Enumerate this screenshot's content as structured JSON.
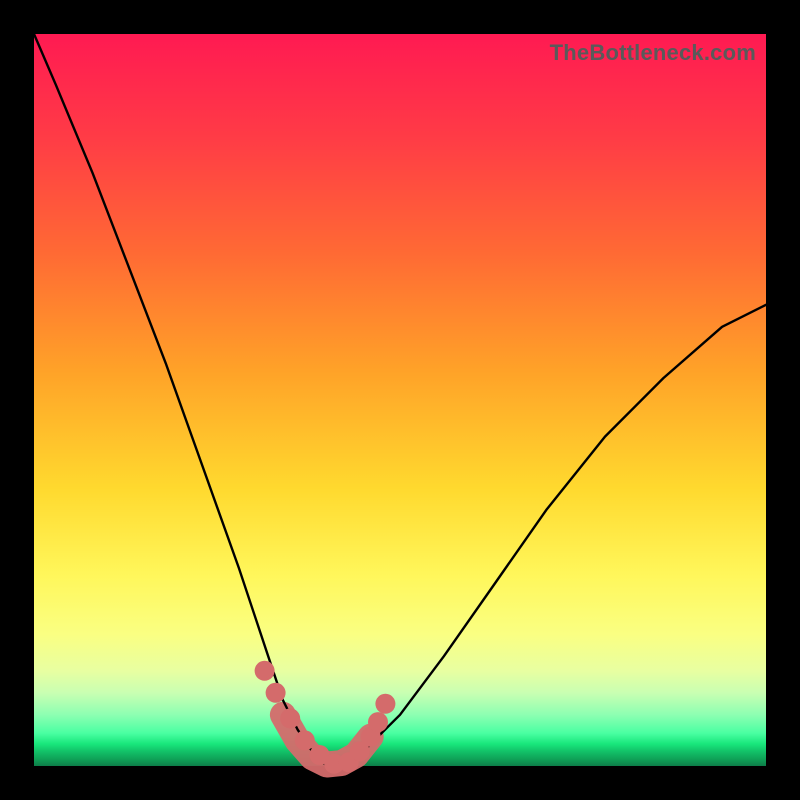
{
  "watermark": "TheBottleneck.com",
  "colors": {
    "frame": "#000000",
    "curve_stroke": "#000000",
    "marker": "#d46b6b",
    "grad_top": "#ff1a52",
    "grad_bottom": "#0d7e49"
  },
  "chart_data": {
    "type": "line",
    "title": "",
    "xlabel": "",
    "ylabel": "",
    "xlim": [
      0,
      100
    ],
    "ylim": [
      0,
      100
    ],
    "series": [
      {
        "name": "bottleneck-curve",
        "x": [
          0,
          3,
          8,
          13,
          18,
          23,
          28,
          32,
          34,
          36,
          38,
          40,
          42,
          44,
          46,
          50,
          56,
          63,
          70,
          78,
          86,
          94,
          100
        ],
        "values": [
          100,
          93,
          81,
          68,
          55,
          41,
          27,
          15,
          9,
          5,
          2,
          0,
          0,
          1,
          3,
          7,
          15,
          25,
          35,
          45,
          53,
          60,
          63
        ]
      }
    ],
    "markers": {
      "name": "highlighted-points",
      "x": [
        31.5,
        33.0,
        35.0,
        37.0,
        39.0,
        41.0,
        43.0,
        44.5,
        46.0,
        47.0,
        48.0
      ],
      "values": [
        13.0,
        10.0,
        6.5,
        3.5,
        1.5,
        0.3,
        0.5,
        2.0,
        4.0,
        6.0,
        8.5
      ]
    },
    "valley_band": {
      "x": [
        34.0,
        36.0,
        38.0,
        40.0,
        42.0,
        44.0,
        46.0
      ],
      "values": [
        7.0,
        3.5,
        1.2,
        0.2,
        0.4,
        1.5,
        4.0
      ]
    },
    "annotations": []
  }
}
